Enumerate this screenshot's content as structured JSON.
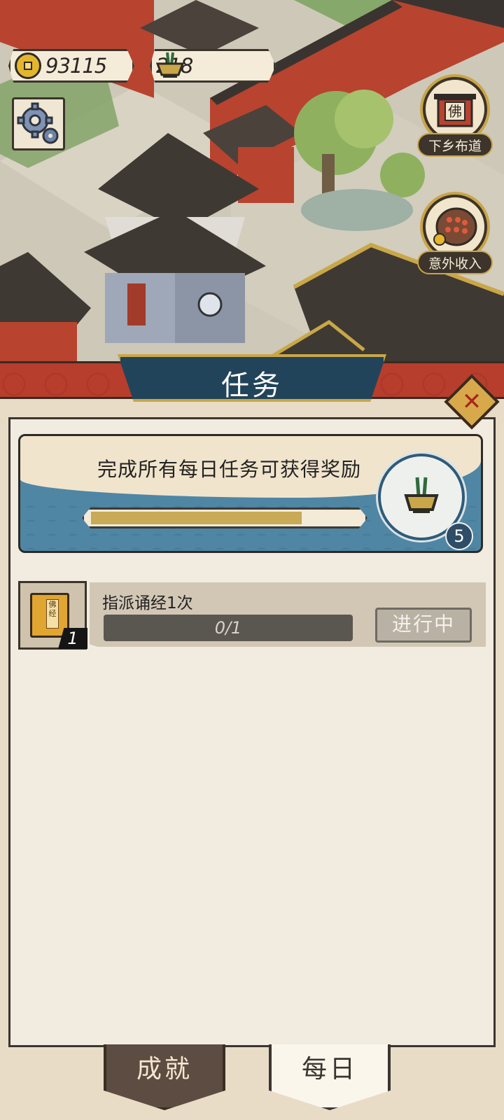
{
  "currency": {
    "coins": "93115",
    "incense": "218"
  },
  "side_buttons": {
    "xiaxiang_label": "下乡布道",
    "xiaxiang_icon_char": "佛",
    "yiwai_label": "意外收入"
  },
  "panel": {
    "title": "任务",
    "close_symbol": "✕"
  },
  "reward": {
    "text": "完成所有每日任务可获得奖励",
    "progress_fraction": 0.8,
    "count": "5"
  },
  "tasks": [
    {
      "name": "指派诵经1次",
      "progress": "0/1",
      "quantity": "1",
      "status": "进行中",
      "book_chars": [
        "佛",
        "经"
      ]
    }
  ],
  "tabs": {
    "achievement": "成就",
    "daily": "每日"
  },
  "colors": {
    "banner_red": "#b73d2d",
    "plaque_blue": "#22445a",
    "gold": "#c9a748",
    "panel_bg": "#f2ebdf"
  }
}
